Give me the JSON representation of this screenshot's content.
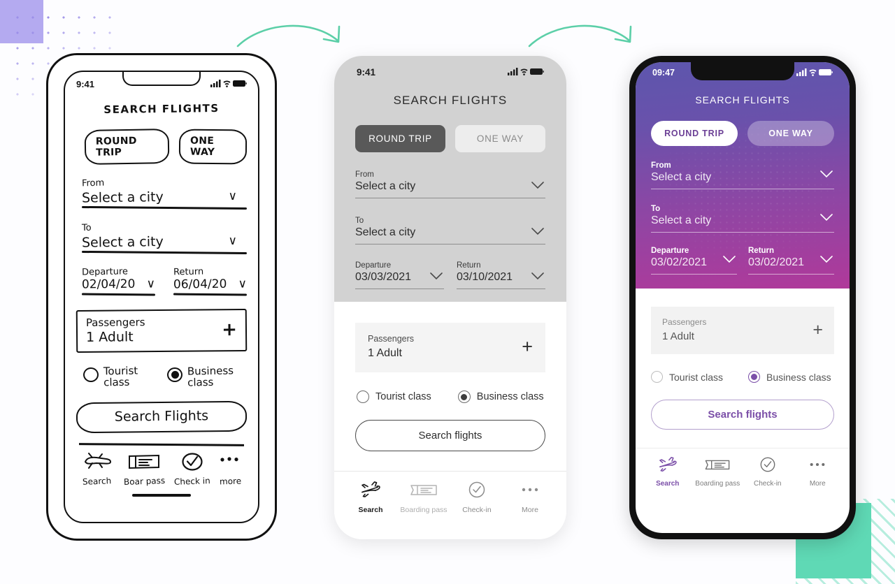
{
  "canvas": {
    "background": "#fdfdff"
  },
  "decorations": {
    "purple_square_color": "#b4aaf0",
    "dot_grid_color": "#9b8fe8",
    "teal_square_color": "#5fd9b5",
    "arrow_color": "#5ccfa8",
    "arrow_left_name": "curved-arrow-wireframe-to-grayscale",
    "arrow_right_name": "curved-arrow-grayscale-to-color"
  },
  "wireframe_phone": {
    "status": {
      "time": "9:41",
      "signal": "signal-icon",
      "wifi": "wifi-icon",
      "battery": "battery-icon"
    },
    "title": "SEARCH FLIGHTS",
    "trip_tabs": [
      {
        "label": "ROUND TRIP",
        "active": true
      },
      {
        "label": "ONE WAY",
        "active": false
      }
    ],
    "from": {
      "label": "From",
      "value": "Select a city",
      "chevron": "chevron-down-icon"
    },
    "to": {
      "label": "To",
      "value": "Select a city",
      "chevron": "chevron-down-icon"
    },
    "departure": {
      "label": "Departure",
      "value": "02/04/20",
      "chevron": "chevron-down-icon"
    },
    "return": {
      "label": "Return",
      "value": "06/04/20",
      "chevron": "chevron-down-icon"
    },
    "passengers": {
      "label": "Passengers",
      "value": "1 Adult",
      "add": "+"
    },
    "classes": [
      {
        "label": "Tourist class",
        "line2": "class",
        "line1": "Tourist",
        "selected": false
      },
      {
        "label": "Business class",
        "line1": "Business",
        "line2": "class",
        "selected": true
      }
    ],
    "cta": "Search Flights",
    "tabbar": [
      {
        "label": "Search",
        "icon": "plane-icon",
        "active": true
      },
      {
        "label": "Boar pass",
        "icon": "ticket-icon",
        "active": false
      },
      {
        "label": "Check in",
        "icon": "check-circle-icon",
        "active": false
      },
      {
        "label": "more",
        "icon": "ellipsis-icon",
        "active": false
      }
    ]
  },
  "grayscale_phone": {
    "status": {
      "time": "9:41",
      "signal": "signal-icon",
      "wifi": "wifi-icon",
      "battery": "battery-icon"
    },
    "title": "SEARCH FLIGHTS",
    "trip_tabs": [
      {
        "label": "ROUND TRIP",
        "active": true
      },
      {
        "label": "ONE WAY",
        "active": false
      }
    ],
    "from": {
      "label": "From",
      "value": "Select a city",
      "chevron": "chevron-down-icon"
    },
    "to": {
      "label": "To",
      "value": "Select a city",
      "chevron": "chevron-down-icon"
    },
    "departure": {
      "label": "Departure",
      "value": "03/03/2021",
      "chevron": "chevron-down-icon"
    },
    "return": {
      "label": "Return",
      "value": "03/10/2021",
      "chevron": "chevron-down-icon"
    },
    "passengers": {
      "label": "Passengers",
      "value": "1 Adult",
      "add": "+"
    },
    "classes": [
      {
        "label": "Tourist class",
        "selected": false
      },
      {
        "label": "Business class",
        "selected": true
      }
    ],
    "cta": "Search flights",
    "tabbar": [
      {
        "label": "Search",
        "icon": "plane-icon",
        "active": true
      },
      {
        "label": "Boarding pass",
        "icon": "ticket-icon",
        "active": false
      },
      {
        "label": "Check-in",
        "icon": "check-circle-icon",
        "active": false
      },
      {
        "label": "More",
        "icon": "ellipsis-icon",
        "active": false
      }
    ],
    "colors": {
      "header_bg": "#d2d2d2",
      "active_tab_bg": "#595959",
      "inactive_tab_bg": "#ededed"
    }
  },
  "color_phone": {
    "status": {
      "time": "09:47",
      "signal": "signal-icon",
      "wifi": "wifi-icon",
      "battery": "battery-icon"
    },
    "title": "SEARCH FLIGHTS",
    "trip_tabs": [
      {
        "label": "ROUND TRIP",
        "active": true
      },
      {
        "label": "ONE WAY",
        "active": false
      }
    ],
    "from": {
      "label": "From",
      "value": "Select a city",
      "chevron": "chevron-down-icon"
    },
    "to": {
      "label": "To",
      "value": "Select a city",
      "chevron": "chevron-down-icon"
    },
    "departure": {
      "label": "Departure",
      "value": "03/02/2021",
      "chevron": "chevron-down-icon"
    },
    "return": {
      "label": "Return",
      "value": "03/02/2021",
      "chevron": "chevron-down-icon"
    },
    "passengers": {
      "label": "Passengers",
      "value": "1 Adult",
      "add": "+"
    },
    "classes": [
      {
        "label": "Tourist class",
        "selected": false
      },
      {
        "label": "Business class",
        "selected": true
      }
    ],
    "cta": "Search flights",
    "tabbar": [
      {
        "label": "Search",
        "icon": "plane-icon",
        "active": true
      },
      {
        "label": "Boarding pass",
        "icon": "ticket-icon",
        "active": false
      },
      {
        "label": "Check-in",
        "icon": "check-circle-icon",
        "active": false
      },
      {
        "label": "More",
        "icon": "ellipsis-icon",
        "active": false
      }
    ],
    "colors": {
      "gradient_top": "#5d56ad",
      "gradient_bottom": "#b0399a",
      "accent": "#7b4fa8",
      "bezel": "#111111"
    }
  }
}
